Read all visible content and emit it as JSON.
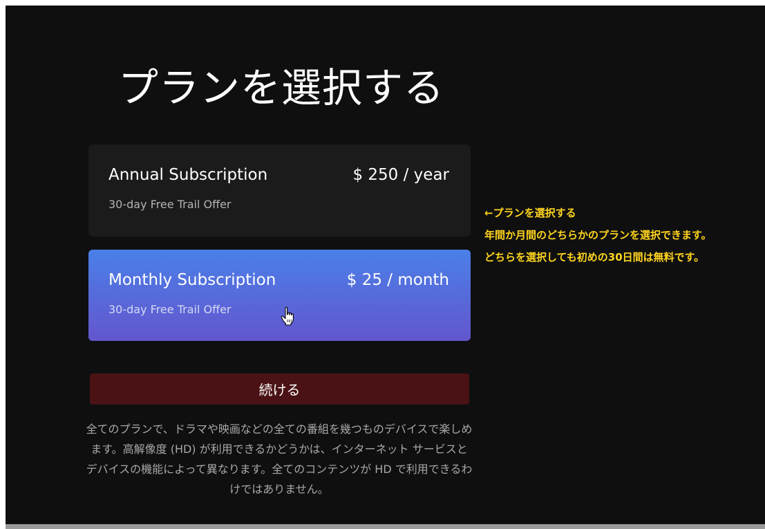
{
  "page": {
    "title": "プランを選択する"
  },
  "plans": [
    {
      "name": "Annual Subscription",
      "price": "$ 250 / year",
      "offer": "30-day Free Trail Offer",
      "selected": false
    },
    {
      "name": "Monthly Subscription",
      "price": "$ 25 / month",
      "offer": "30-day Free Trail Offer",
      "selected": true
    }
  ],
  "continue_label": "続ける",
  "disclaimer": "全てのプランで、ドラマや映画などの全ての番組を幾つものデバイスで楽しめます。高解像度 (HD) が利用できるかどうかは、インターネット サービスとデバイスの機能によって異なります。全てのコンテンツが HD で利用できるわけではありません。",
  "annotation": {
    "lines": [
      "←プランを選択する",
      "年間か月間のどちらかのプランを選択できます。",
      "どちらを選択しても初めの30日間は無料です。"
    ]
  },
  "icons": {
    "cursor": "hand-pointer-icon"
  },
  "colors": {
    "background": "#0f0f0f",
    "annual_card": "#1b1b1b",
    "monthly_card_top": "#4a80e8",
    "monthly_card_bottom": "#6356cd",
    "continue_button": "#4a1214",
    "annotation_text": "#ffd51e"
  }
}
